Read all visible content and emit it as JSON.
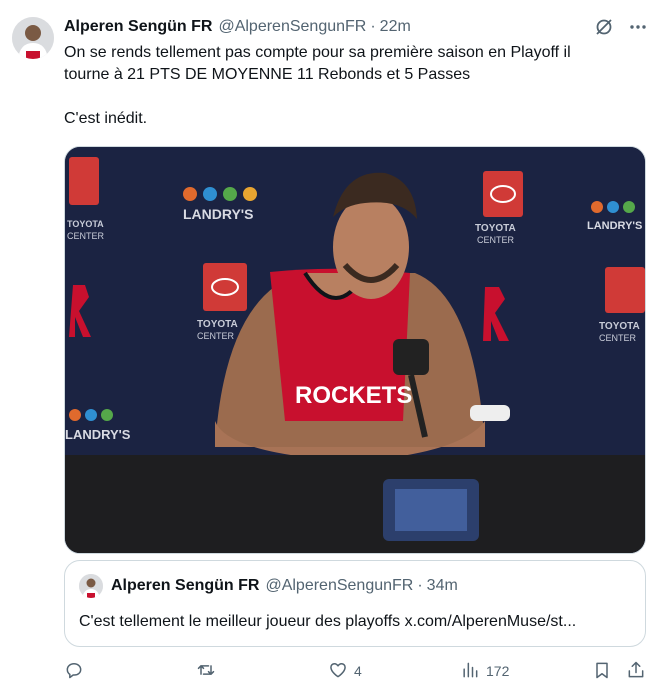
{
  "tweet": {
    "author_name": "Alperen Sengün FR",
    "author_handle": "@AlperenSengunFR",
    "separator": "·",
    "time": "22m",
    "text_line1": "On se rends tellement pas compte pour sa première saison en Playoff il",
    "text_line2": "tourne à 21 PTS DE MOYENNE 11 Rebonds et 5 Passes",
    "text_line3": "C'est inédit.",
    "media": {
      "jersey_text": "ROCKETS",
      "backdrop_brand": "TOYOTA CENTER",
      "backdrop_brand_line1": "TOYOTA",
      "backdrop_brand_line2": "CENTER",
      "backdrop_sponsor": "LANDRY'S"
    }
  },
  "quote": {
    "author_name": "Alperen Sengün FR",
    "author_handle": "@AlperenSengunFR",
    "separator": "·",
    "time": "34m",
    "text": "C'est tellement le meilleur joueur des playoffs x.com/AlperenMuse/st..."
  },
  "actions": {
    "reply_count": "",
    "retweet_count": "",
    "like_count": "4",
    "views_count": "172"
  },
  "colors": {
    "text_primary": "#0f1419",
    "text_secondary": "#536471",
    "border": "#cfd9de",
    "backdrop": "#1a2240",
    "jersey_red": "#c8102e"
  },
  "icons": [
    "grok-icon",
    "more-icon",
    "reply-icon",
    "retweet-icon",
    "like-icon",
    "views-icon",
    "bookmark-icon",
    "share-icon"
  ]
}
